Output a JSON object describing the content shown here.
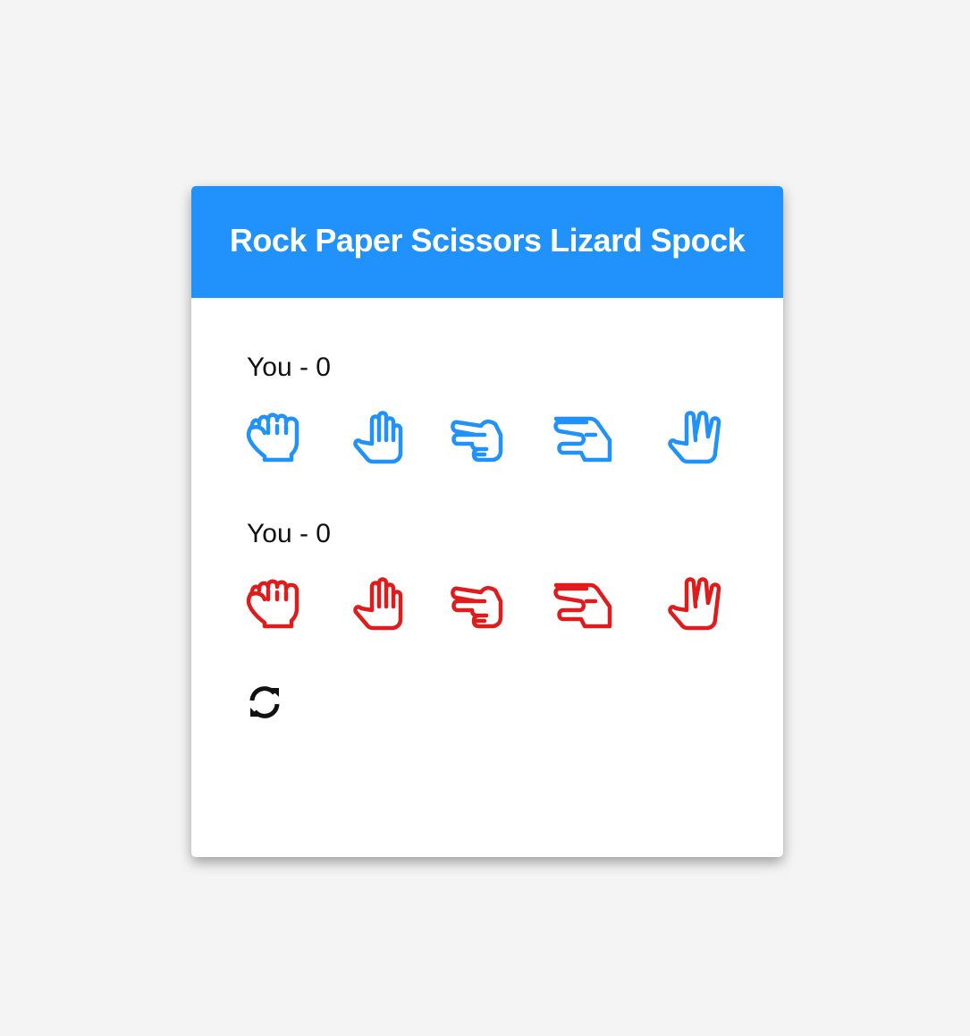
{
  "header": {
    "title": "Rock Paper Scissors Lizard Spock",
    "background": "#2191fb"
  },
  "player": {
    "score_label": "You - 0",
    "color": "#2191fb",
    "hands": [
      "rock-icon",
      "paper-icon",
      "scissors-icon",
      "lizard-icon",
      "spock-icon"
    ]
  },
  "computer": {
    "score_label": "You - 0",
    "color": "#e01b1b",
    "hands": [
      "rock-icon",
      "paper-icon",
      "scissors-icon",
      "lizard-icon",
      "spock-icon"
    ]
  },
  "reset": {
    "icon": "refresh-icon"
  }
}
